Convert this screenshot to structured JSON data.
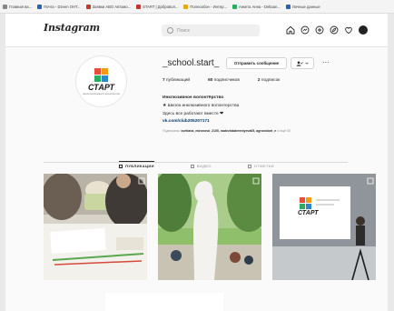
{
  "bookmarks": [
    {
      "label": "Главная ва...",
      "color": "#888888"
    },
    {
      "label": "Почта - Dzeen ОНТ...",
      "color": "#2f5fb5"
    },
    {
      "label": "Заявки ABO Автомо...",
      "color": "#c0392b"
    },
    {
      "label": "START | Добровол...",
      "color": "#c0392b"
    },
    {
      "label": "Полнообэн - Интер...",
      "color": "#e6a817"
    },
    {
      "label": "Анкета Анна - Deltaan...",
      "color": "#27ae60"
    },
    {
      "label": "Личные данные",
      "color": "#2f5fb5"
    }
  ],
  "header": {
    "logo": "Instagram",
    "search_placeholder": "Поиск"
  },
  "profile": {
    "username": "_school.start_",
    "message_button": "Отправить сообщение",
    "follow_icon": "user-check-icon",
    "more": "···",
    "avatar": {
      "title": "СТАРТ",
      "subtitle": "школа инклюзивного волонтерства",
      "colors": [
        "#e74c3c",
        "#f39c12",
        "#27ae60",
        "#2f86c8"
      ]
    },
    "stats": {
      "posts_count": "7",
      "posts_label": "публикаций",
      "followers_count": "60",
      "followers_label": "подписчиков",
      "following_count": "2",
      "following_label": "подписок"
    },
    "bio": {
      "name": "Инклюзивное волонтёрство",
      "line1": "★ Школа инклюзивного волонтерства",
      "line2": "Здесь все работают вместе ❤",
      "link": "vk.com/club205207171"
    },
    "followed_by": {
      "prefix": "Подписаны:",
      "names": "svetlana_mironova_2105, nadezhdaterentyeva05, agrovolont_e",
      "suffix": "и ещё 50"
    }
  },
  "tabs": [
    {
      "label": "ПУБЛИКАЦИИ",
      "icon": "grid-icon",
      "active": true
    },
    {
      "label": "ВИДЕО",
      "icon": "video-icon",
      "active": false
    },
    {
      "label": "ОТМЕТКИ",
      "icon": "tag-icon",
      "active": false
    }
  ],
  "posts": [
    {
      "description": "workshop-table-photo"
    },
    {
      "description": "outdoor-event-photo"
    },
    {
      "description": "presentation-screen-photo",
      "screen_title": "СТАРТ"
    }
  ]
}
